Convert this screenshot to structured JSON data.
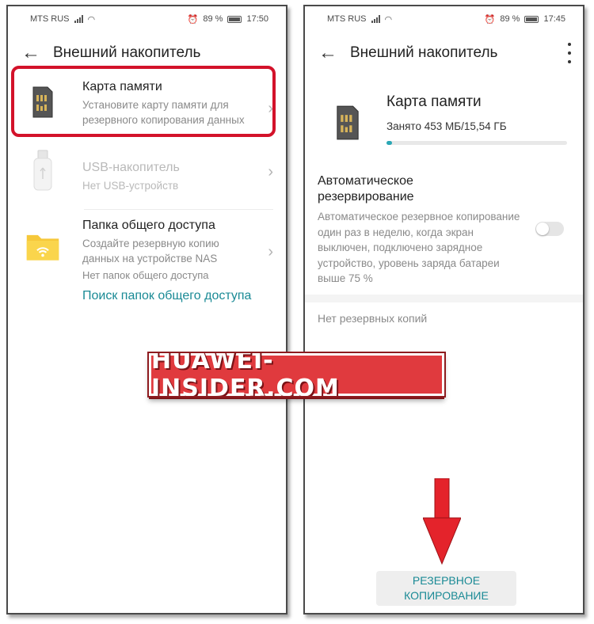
{
  "status_bar": {
    "carrier": "MTS RUS",
    "battery_left": "89 %",
    "time_left": "17:50",
    "battery_right": "89 %",
    "time_right": "17:45"
  },
  "left_screen": {
    "title": "Внешний накопитель",
    "memory_card": {
      "title": "Карта памяти",
      "subtitle": "Установите карту памяти для резервного копирования данных"
    },
    "usb": {
      "title": "USB-накопитель",
      "subtitle": "Нет USB-устройств"
    },
    "shared_folder": {
      "title": "Папка общего доступа",
      "subtitle": "Создайте резервную копию данных на устройстве NAS",
      "status": "Нет папок общего доступа",
      "link": "Поиск папок общего доступа"
    }
  },
  "right_screen": {
    "title": "Внешний накопитель",
    "card": {
      "title": "Карта памяти",
      "usage": "Занято 453 МБ/15,54 ГБ",
      "usage_fraction": 0.03
    },
    "auto_backup": {
      "title": "Автоматическое резервирование",
      "description": "Автоматическое резервное копирование один раз в неделю, когда экран выключен, подключено зарядное устройство, уровень заряда батареи выше 75 %",
      "enabled": false
    },
    "no_backups": "Нет резервных копий",
    "backup_button": "РЕЗЕРВНОЕ КОПИРОВАНИЕ"
  },
  "watermark": "HUAWEI-INSIDER.COM",
  "colors": {
    "accent": "#1a8a95",
    "highlight": "#d3122a",
    "arrow": "#e4232b",
    "progress": "#2aa7b5",
    "folder": "#f6c83a"
  },
  "icons": [
    "back-icon",
    "sd-card-icon",
    "usb-icon",
    "folder-icon",
    "chevron-right-icon",
    "more-icon",
    "arrow-down-icon"
  ]
}
